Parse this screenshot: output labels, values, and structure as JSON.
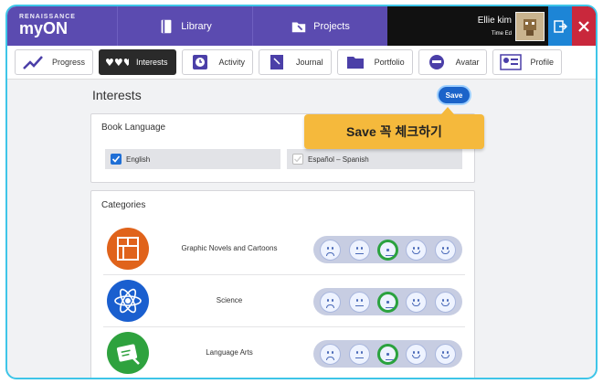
{
  "brand": {
    "sub": "RENAISSANCE",
    "main": "myON"
  },
  "topnav": [
    {
      "label": "Library",
      "icon": "book-icon"
    },
    {
      "label": "Projects",
      "icon": "folder-icon"
    }
  ],
  "user": {
    "name": "Ellie kim",
    "time_label": "Time Ed"
  },
  "tabs": [
    {
      "label": "Progress",
      "icon": "progress-chart-icon",
      "active": false
    },
    {
      "label": "Interests",
      "icon": "hearts-icon",
      "active": true
    },
    {
      "label": "Activity",
      "icon": "clock-icon",
      "active": false
    },
    {
      "label": "Journal",
      "icon": "journal-icon",
      "active": false
    },
    {
      "label": "Portfolio",
      "icon": "portfolio-folder-icon",
      "active": false
    },
    {
      "label": "Avatar",
      "icon": "avatar-icon",
      "active": false
    },
    {
      "label": "Profile",
      "icon": "profile-icon",
      "active": false
    }
  ],
  "page": {
    "title": "Interests",
    "save_label": "Save"
  },
  "callout": {
    "text": "Save 꼭 체크하기"
  },
  "book_language": {
    "heading": "Book Language",
    "options": [
      {
        "label": "English",
        "checked": true
      },
      {
        "label": "Español – Spanish",
        "checked": false
      }
    ]
  },
  "categories": {
    "heading": "Categories",
    "rows": [
      {
        "name": "Graphic Novels and Cartoons",
        "icon": "graphic-novel-icon",
        "color": "#e0631b",
        "selected_rating": 3
      },
      {
        "name": "Science",
        "icon": "atom-icon",
        "color": "#1a5fcf",
        "selected_rating": 3
      },
      {
        "name": "Language Arts",
        "icon": "language-arts-icon",
        "color": "#2ea23e",
        "selected_rating": 3
      }
    ],
    "rating_faces": [
      "sad",
      "neutral",
      "neutral",
      "happy",
      "happy"
    ]
  },
  "colors": {
    "topbar": "#5b4bb0",
    "accent": "#1b63c9",
    "callout": "#f5b93c",
    "selected": "#2aa23e"
  }
}
